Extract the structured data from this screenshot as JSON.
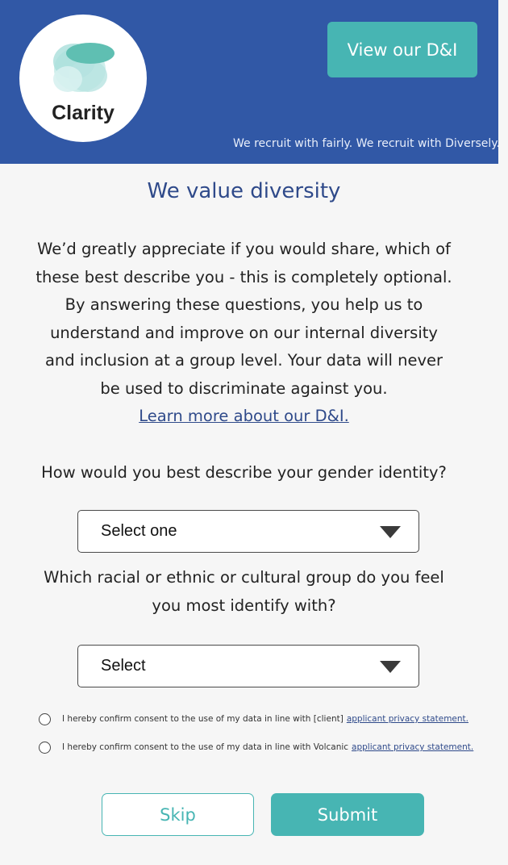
{
  "header": {
    "logo_text": "Clarity",
    "dni_button_label": "View our D&I",
    "tagline": "We recruit with fairly. We recruit with Diversely."
  },
  "main": {
    "title": "We value diversity",
    "intro_lines": [
      "We’d greatly appreciate if you would share, which of",
      "these best describe you - this is completely optional.",
      "By answering these questions, you help us to",
      "understand and improve on our internal diversity",
      "and inclusion at a group level. Your data will never",
      "be used to discriminate against you."
    ],
    "learn_more_link": "Learn more about our D&I.",
    "gender_question": "How would you best describe your gender identity?",
    "gender_select_value": "Select one",
    "ethnicity_question_line1": "Which racial or ethnic or cultural group do you feel",
    "ethnicity_question_line2": "you most identify with?",
    "ethnicity_select_value": "Select",
    "consent": [
      {
        "text": "I hereby confirm consent to the use of my data in line with [client]",
        "link": "applicant privacy statement."
      },
      {
        "text": "I hereby confirm consent to the use of my data in line with Volcanic",
        "link": "applicant privacy statement."
      }
    ],
    "skip_label": "Skip",
    "submit_label": "Submit"
  },
  "colors": {
    "header_bg": "#3158a6",
    "accent_teal": "#47b5b3",
    "title_blue": "#2f4a8a"
  }
}
